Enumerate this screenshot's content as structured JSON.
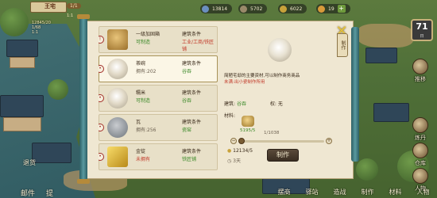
{
  "hud": {
    "title": "王宅",
    "badge": "1/1",
    "subtitle": "1:1",
    "coin_lines": [
      "12845/20",
      "1/68",
      "1:1"
    ],
    "resources": [
      {
        "value": "13814",
        "color": "#6b8fbf"
      },
      {
        "value": "5702",
        "color": "#9a8a6a"
      },
      {
        "value": "6022",
        "color": "#c8a23a"
      },
      {
        "value": "19",
        "color": "#d89a3a"
      }
    ],
    "turn": {
      "number": "71",
      "day": "日"
    }
  },
  "side_buttons": [
    {
      "label": "推移",
      "icon": "bell-icon"
    },
    {
      "label": "炼丹",
      "icon": "cauldron-icon"
    },
    {
      "label": "仓库",
      "icon": "warehouse-icon"
    },
    {
      "label": "人物",
      "icon": "person-icon"
    }
  ],
  "bottom_left": [
    "邮件",
    "提"
  ],
  "scroll_label": "退货",
  "bottom_bar": [
    "摆商",
    "驿站",
    "造战",
    "制作",
    "材料",
    "人物"
  ],
  "crafting": {
    "tab_label": "制作",
    "list": [
      {
        "name": "一级加固箱",
        "status": "可制造",
        "status_color": "ok",
        "cond_label": "建筑条件",
        "cond_value": "工业/工商/铁匠铺",
        "cond_color": "bad",
        "marker": "!",
        "selected": false,
        "thumb": "crate-icon"
      },
      {
        "name": "茶碗",
        "status": "拥有:202",
        "status_color": "grey",
        "cond_label": "建筑条件",
        "cond_value": "谷吞",
        "cond_color": "ok",
        "marker": "•",
        "selected": true,
        "thumb": "bowl-icon"
      },
      {
        "name": "糯米",
        "status": "可制造",
        "status_color": "ok",
        "cond_label": "建筑条件",
        "cond_value": "谷吞",
        "cond_color": "ok",
        "marker": "•",
        "selected": false,
        "thumb": "rice-icon"
      },
      {
        "name": "瓦",
        "status": "拥有:256",
        "status_color": "grey",
        "cond_label": "建筑条件",
        "cond_value": "瓷窑",
        "cond_color": "ok",
        "marker": "•",
        "selected": false,
        "thumb": "tile-icon"
      },
      {
        "name": "金锭",
        "status": "未拥有",
        "status_color": "bad",
        "cond_label": "建筑条件",
        "cond_value": "铁匠铺",
        "cond_color": "ok",
        "marker": "•",
        "selected": false,
        "thumb": "gold-icon"
      }
    ],
    "detail": {
      "desc": "简陋宅邸的主要资材,可以制作商务商品",
      "effect": "未满:出小瓷制作所用",
      "build_label": "建筑:",
      "build_value": "谷吞",
      "extra_label": "权:",
      "extra_value": "无",
      "materials_label": "材料:",
      "material_count": "5195/5",
      "qty": "1/1038",
      "slider_fraction": 0.001,
      "money": "12134/5",
      "time": "3天",
      "make_label": "制作"
    }
  }
}
